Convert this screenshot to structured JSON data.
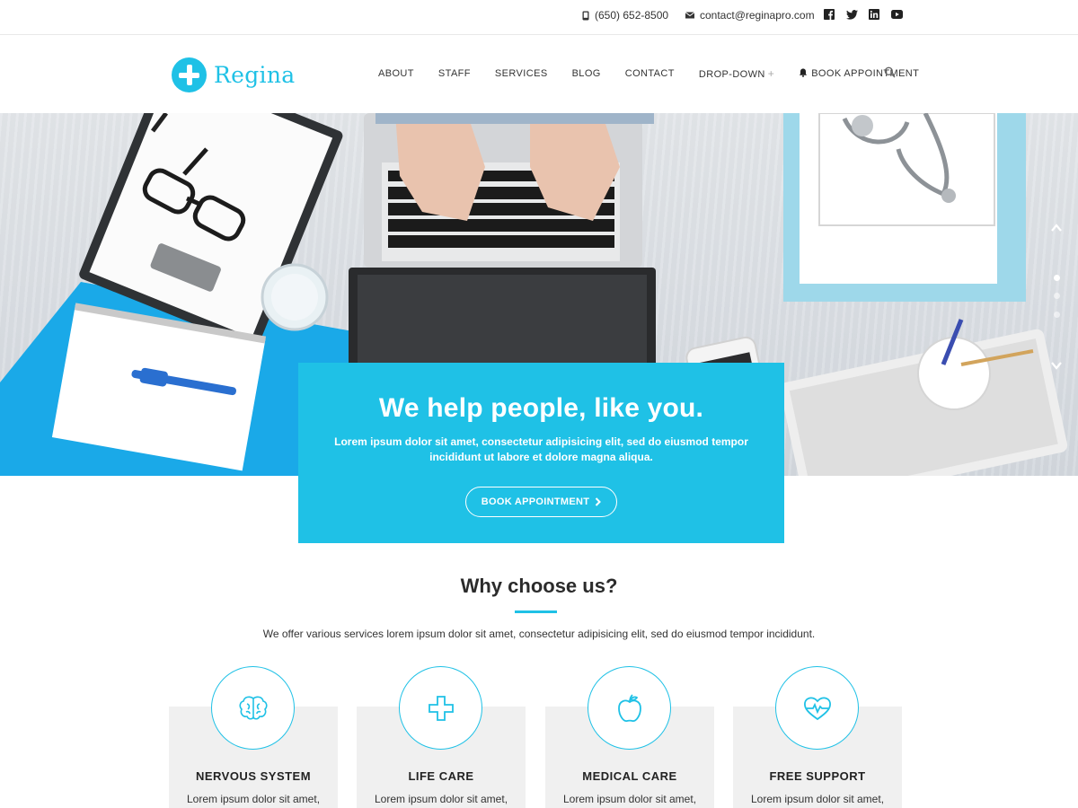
{
  "topbar": {
    "phone": "(650) 652-8500",
    "email": "contact@reginapro.com",
    "socials": [
      "facebook-icon",
      "twitter-icon",
      "linkedin-icon",
      "youtube-icon"
    ]
  },
  "header": {
    "logo_text": "Regina",
    "nav": [
      {
        "label": "ABOUT"
      },
      {
        "label": "STAFF"
      },
      {
        "label": "SERVICES"
      },
      {
        "label": "BLOG"
      },
      {
        "label": "CONTACT"
      },
      {
        "label": "DROP-DOWN"
      },
      {
        "label": "BOOK APPOINTMENT"
      }
    ]
  },
  "hero": {
    "title": "We help people, like you.",
    "text": "Lorem ipsum dolor sit amet, consectetur adipisicing elit, sed do eiusmod tempor incididunt ut labore et dolore magna aliqua.",
    "button_label": "BOOK APPOINTMENT",
    "slides_count": 3,
    "active_slide": 1
  },
  "why": {
    "title": "Why choose us?",
    "subtitle": "We offer various services lorem ipsum dolor sit amet, consectetur adipisicing elit, sed do eiusmod tempor incididunt.",
    "cards": [
      {
        "title": "NERVOUS SYSTEM",
        "text": "Lorem ipsum dolor sit amet,",
        "icon": "brain-icon"
      },
      {
        "title": "LIFE CARE",
        "text": "Lorem ipsum dolor sit amet,",
        "icon": "medical-cross-icon"
      },
      {
        "title": "MEDICAL CARE",
        "text": "Lorem ipsum dolor sit amet,",
        "icon": "apple-icon"
      },
      {
        "title": "FREE SUPPORT",
        "text": "Lorem ipsum dolor sit amet,",
        "icon": "heart-pulse-icon"
      }
    ]
  },
  "colors": {
    "accent": "#1fc1e6",
    "card_bg": "#f0f0f0",
    "text_dark": "#2b2b2b"
  }
}
